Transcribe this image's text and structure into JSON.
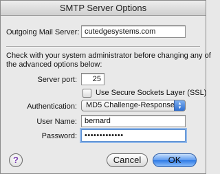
{
  "dialog": {
    "title": "SMTP Server Options"
  },
  "outgoing": {
    "label": "Outgoing Mail Server:",
    "value": "cutedgesystems.com"
  },
  "note": {
    "line1": "Check with your system administrator before changing any of",
    "line2": "the advanced options below:"
  },
  "port": {
    "label": "Server port:",
    "value": "25"
  },
  "ssl": {
    "label": "Use Secure Sockets Layer (SSL)",
    "checked": false
  },
  "auth": {
    "label": "Authentication:",
    "selected": "MD5 Challenge-Response"
  },
  "username": {
    "label": "User Name:",
    "value": "bernard"
  },
  "password": {
    "label": "Password:",
    "value": "•••••••••••••"
  },
  "buttons": {
    "help": "?",
    "cancel": "Cancel",
    "ok": "OK"
  },
  "colors": {
    "accent": "#2d7ae5",
    "focus_ring": "#93b9ea"
  }
}
